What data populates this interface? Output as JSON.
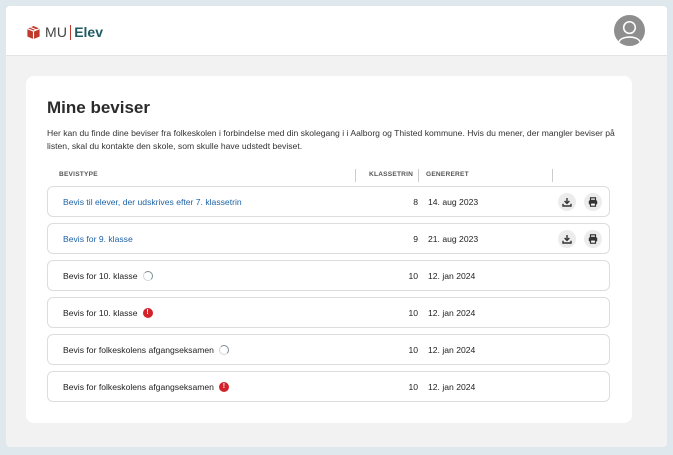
{
  "header": {
    "logo_mu": "MU",
    "logo_elev": "Elev"
  },
  "page": {
    "title": "Mine beviser",
    "description": "Her kan du finde dine beviser fra folkeskolen i forbindelse med din skolegang i i Aalborg og Thisted kommune. Hvis du mener, der mangler beviser på listen, skal du kontakte den skole, som skulle have udstedt beviset."
  },
  "table": {
    "headers": {
      "type": "BEVISTYPE",
      "klassetrin": "KLASSETRIN",
      "genereret": "GENERERET"
    },
    "rows": [
      {
        "name": "Bevis til elever, der udskrives efter 7. klassetrin",
        "klassetrin": "8",
        "date": "14. aug 2023",
        "status": "ready"
      },
      {
        "name": "Bevis for 9. klasse",
        "klassetrin": "9",
        "date": "21. aug 2023",
        "status": "ready"
      },
      {
        "name": "Bevis for 10. klasse",
        "klassetrin": "10",
        "date": "12. jan 2024",
        "status": "loading"
      },
      {
        "name": "Bevis for 10. klasse",
        "klassetrin": "10",
        "date": "12. jan 2024",
        "status": "error",
        "error_mark": "!"
      },
      {
        "name": "Bevis for folkeskolens afgangseksamen",
        "klassetrin": "10",
        "date": "12. jan 2024",
        "status": "loading"
      },
      {
        "name": "Bevis for folkeskolens afgangseksamen",
        "klassetrin": "10",
        "date": "12. jan 2024",
        "status": "error",
        "error_mark": "!"
      }
    ]
  },
  "icons": {
    "logo": "gift-box-logo-icon",
    "avatar": "user-avatar-icon",
    "download": "download-icon",
    "print": "print-icon",
    "loading": "spinner-icon",
    "error": "error-icon"
  },
  "colors": {
    "link": "#1e63a6",
    "brand_red": "#c0392b",
    "brand_teal": "#1f5b63",
    "error": "#d3222a"
  }
}
